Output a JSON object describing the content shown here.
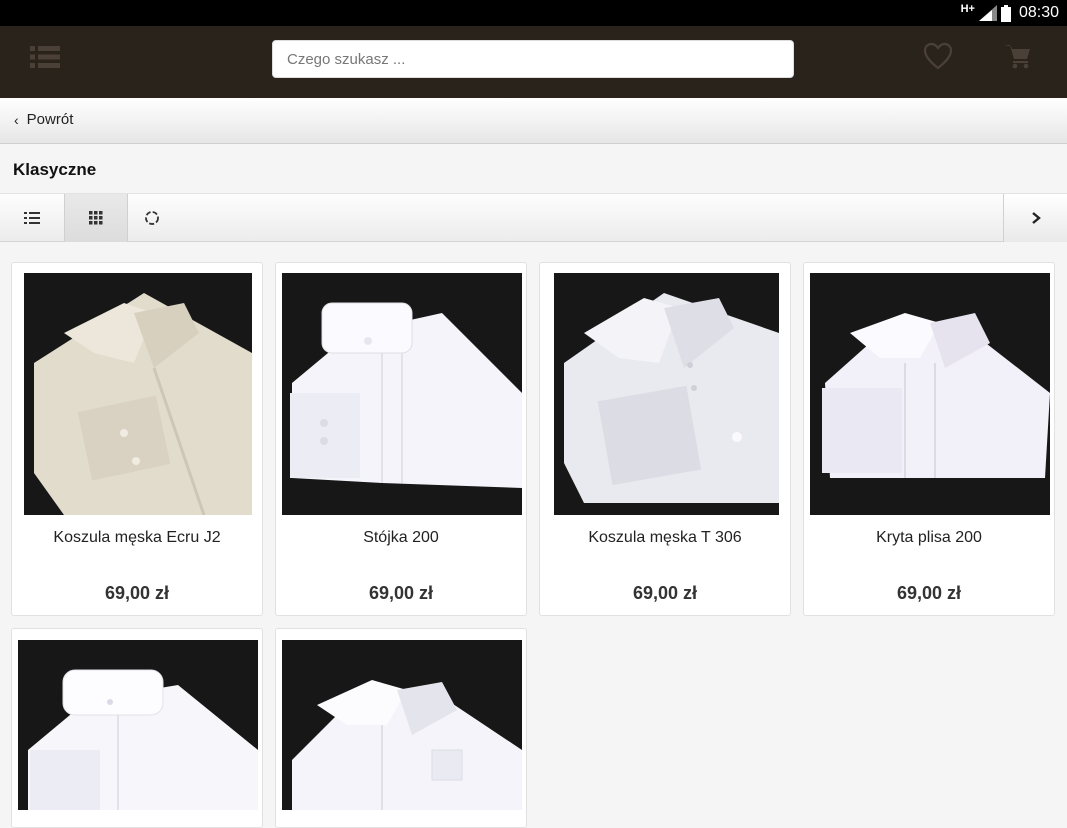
{
  "status_bar": {
    "network": "H+",
    "time": "08:30"
  },
  "header": {
    "search_placeholder": "Czego szukasz ...",
    "icons": [
      "menu-icon",
      "heart-icon",
      "cart-icon"
    ]
  },
  "nav": {
    "back_label": "Powrót"
  },
  "category": {
    "title": "Klasyczne"
  },
  "view_toolbar": {
    "icons": [
      "list-view-icon",
      "grid-view-icon",
      "refresh-icon",
      "chevron-right-icon"
    ],
    "active": "grid"
  },
  "products": [
    {
      "name": "Koszula męska Ecru J2",
      "price": "69,00 zł",
      "color": "#e6e0d2"
    },
    {
      "name": "Stójka 200",
      "price": "69,00 zł",
      "color": "#f4f4fa"
    },
    {
      "name": "Koszula męska T 306",
      "price": "69,00 zł",
      "color": "#eeeef4"
    },
    {
      "name": "Kryta plisa 200",
      "price": "69,00 zł",
      "color": "#f4f2fa"
    },
    {
      "name": "",
      "price": "",
      "color": "#f4f4fa"
    },
    {
      "name": "",
      "price": "",
      "color": "#f4f4fa"
    }
  ],
  "colors": {
    "header_bg": "#2a231c",
    "status_bg": "#000000",
    "page_bg": "#f5f5f5"
  }
}
